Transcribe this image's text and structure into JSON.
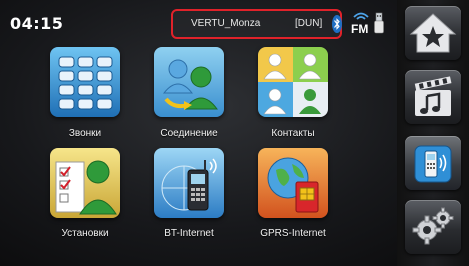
{
  "status_bar": {
    "time": "04:15",
    "device_name": "VERTU_Monza",
    "profile": "[DUN]",
    "fm_label": "FM"
  },
  "tiles": [
    {
      "label": "Звонки"
    },
    {
      "label": "Соединение"
    },
    {
      "label": "Контакты"
    },
    {
      "label": "Установки"
    },
    {
      "label": "BT-Internet"
    },
    {
      "label": "GPRS-Internet"
    }
  ],
  "sidebar": {
    "buttons": [
      {
        "icon": "home-star-icon"
      },
      {
        "icon": "media-icon"
      },
      {
        "icon": "phone-bluetooth-icon",
        "active": true
      },
      {
        "icon": "settings-gears-icon"
      }
    ]
  },
  "colors": {
    "highlight_border": "#e0222a",
    "active_accent": "#2f8fd6"
  }
}
